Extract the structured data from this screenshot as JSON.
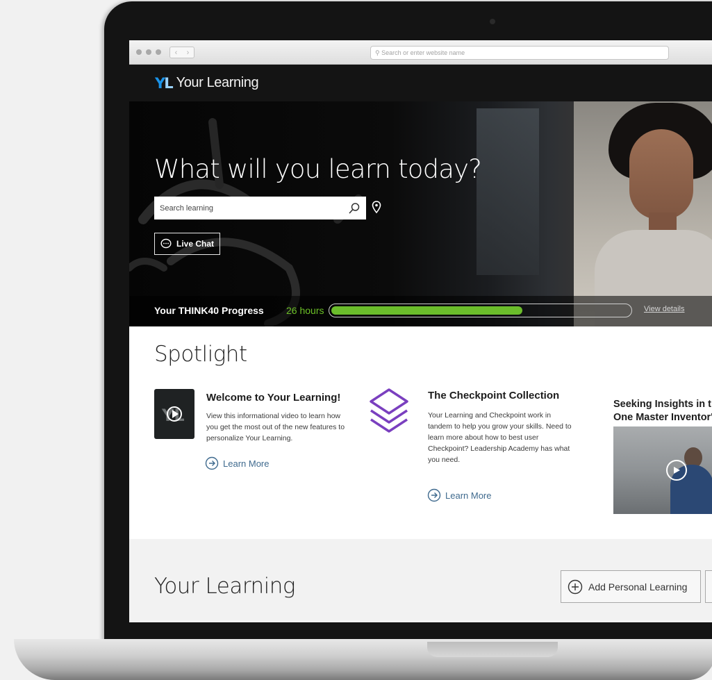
{
  "browser": {
    "url_placeholder": "Search or enter website name",
    "back_label": "‹",
    "forward_label": "›"
  },
  "app": {
    "logo_y": "Y",
    "logo_l": "L",
    "title": "Your Learning",
    "brand_color": "#1a93e8"
  },
  "hero": {
    "title": "What will you learn today?",
    "search_placeholder": "Search learning",
    "live_chat_label": "Live Chat",
    "progress_label": "Your THINK40 Progress",
    "progress_hours": "26 hours",
    "progress_fraction": 0.64,
    "view_details_label": "View details",
    "accent_color": "#6bbd2b"
  },
  "spotlight": {
    "title": "Spotlight",
    "cards": [
      {
        "title": "Welcome to Your Learning!",
        "description": "View this informational video to learn how you get the most out of the new features to personalize Your Learning.",
        "link": "Learn More"
      },
      {
        "title": "The Checkpoint Collection",
        "description": "Your Learning and Checkpoint work in tandem to help you grow your skills. Need to learn more about how to best user Checkpoint? Leadership Academy has what you need.",
        "link": "Learn More"
      },
      {
        "title_line1": "Seeking Insights in th",
        "title_line2": "One Master Inventor'"
      }
    ]
  },
  "your_learning": {
    "title": "Your Learning",
    "add_button_label": "Add Personal Learning"
  }
}
